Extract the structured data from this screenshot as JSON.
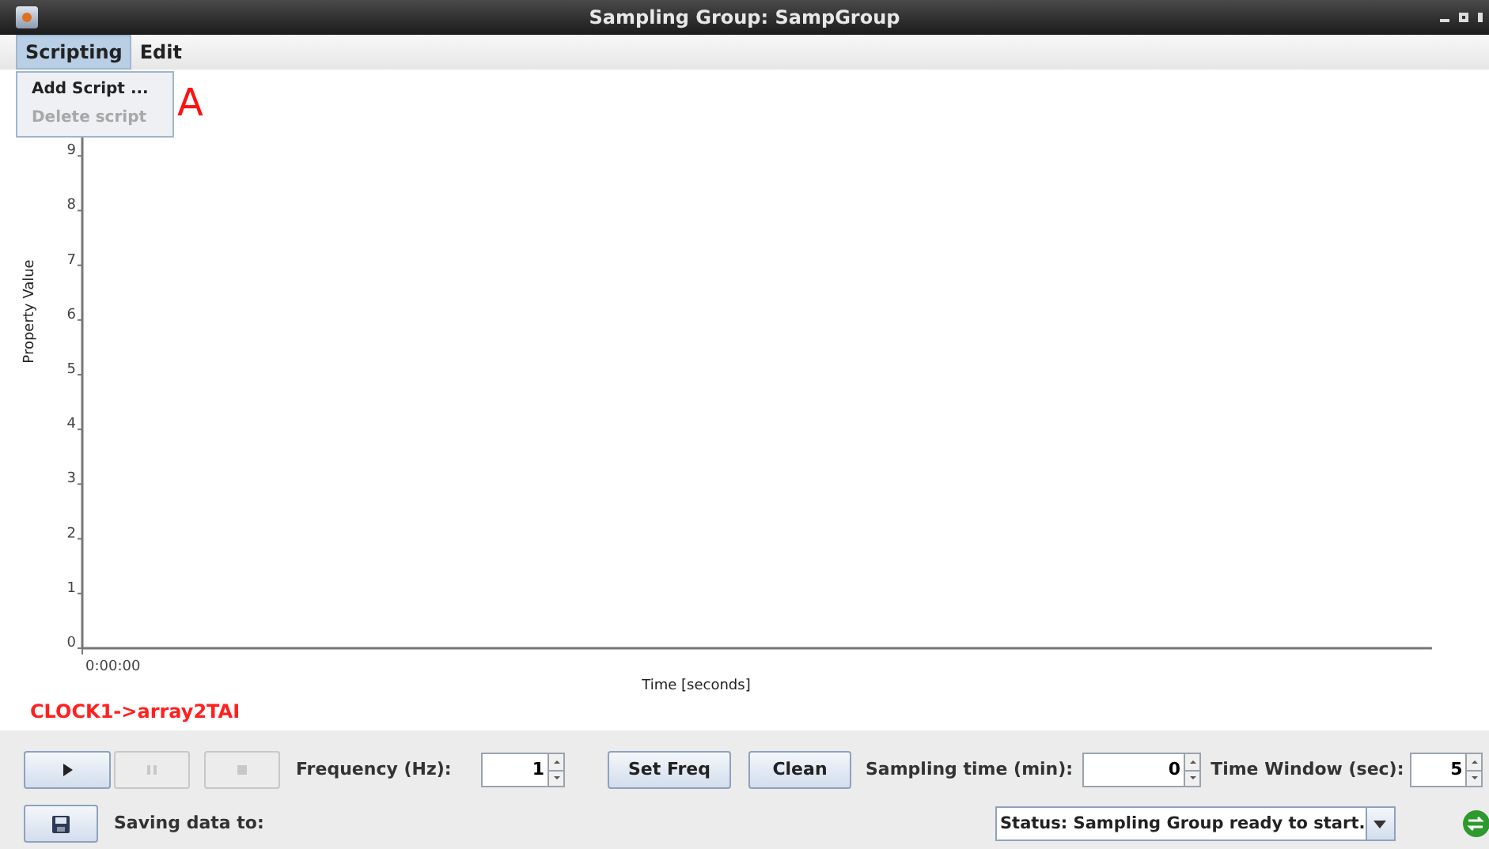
{
  "window": {
    "title": "Sampling Group: SampGroup"
  },
  "menu_bar": [
    {
      "label": "Scripting",
      "selected": true
    },
    {
      "label": "Edit",
      "selected": false
    }
  ],
  "menu_dropdown": [
    {
      "label": "Add Script ...",
      "disabled": false
    },
    {
      "label": "Delete script",
      "disabled": true
    }
  ],
  "annotation": "A",
  "chart": {
    "y_axis_title": "Property Value",
    "y_tick_labels": [
      "9",
      "8",
      "7",
      "6",
      "5",
      "4",
      "3",
      "2",
      "1",
      "0"
    ],
    "x_start_label": "0:00:00",
    "x_axis_title": "Time [seconds]"
  },
  "series_label": "CLOCK1->array2TAI",
  "transport_buttons": [
    {
      "kind": "play",
      "disabled": false
    },
    {
      "kind": "pause",
      "disabled": true
    },
    {
      "kind": "stop",
      "disabled": true
    }
  ],
  "frequency": {
    "label": "Frequency (Hz):",
    "value": "1"
  },
  "buttons": [
    "Set Freq",
    "Clean"
  ],
  "sampling_time": {
    "label": "Sampling time (min):",
    "value": "0"
  },
  "time_window": {
    "label": "Time Window (sec):",
    "value": "5"
  },
  "saving_label": "Saving data to:",
  "status": "Status: Sampling Group ready to start."
}
